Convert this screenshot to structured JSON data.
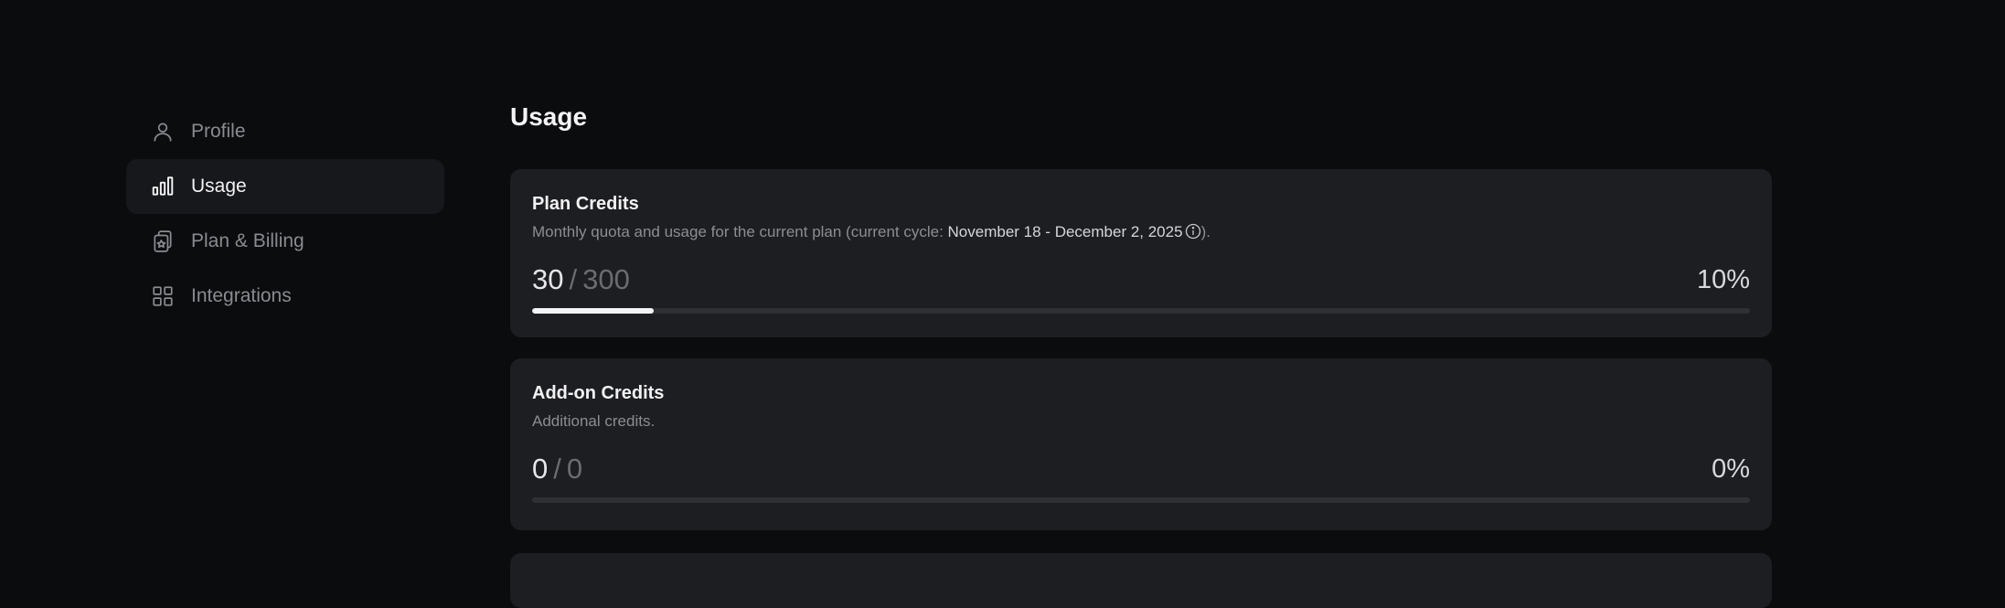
{
  "sidebar": {
    "items": [
      {
        "label": "Profile",
        "icon": "user-icon",
        "active": false
      },
      {
        "label": "Usage",
        "icon": "bar-chart-icon",
        "active": true
      },
      {
        "label": "Plan & Billing",
        "icon": "billing-icon",
        "active": false
      },
      {
        "label": "Integrations",
        "icon": "grid-icon",
        "active": false
      }
    ]
  },
  "main": {
    "title": "Usage",
    "cards": [
      {
        "title": "Plan Credits",
        "desc_prefix": "Monthly quota and usage for the current plan (current cycle: ",
        "desc_highlight": "November 18 - December 2, 2025",
        "desc_suffix": ").",
        "used": "30",
        "separator": "/",
        "total": "300",
        "percent": "10%",
        "fraction": 0.1
      },
      {
        "title": "Add-on Credits",
        "desc": "Additional credits.",
        "used": "0",
        "separator": "/",
        "total": "0",
        "percent": "0%",
        "fraction": 0
      }
    ]
  },
  "colors": {
    "background": "#0b0c0e",
    "card": "#1d1e21",
    "active_nav": "#17181b",
    "bar_fill": "#f4f4f6",
    "bar_track": "#2f3034"
  }
}
